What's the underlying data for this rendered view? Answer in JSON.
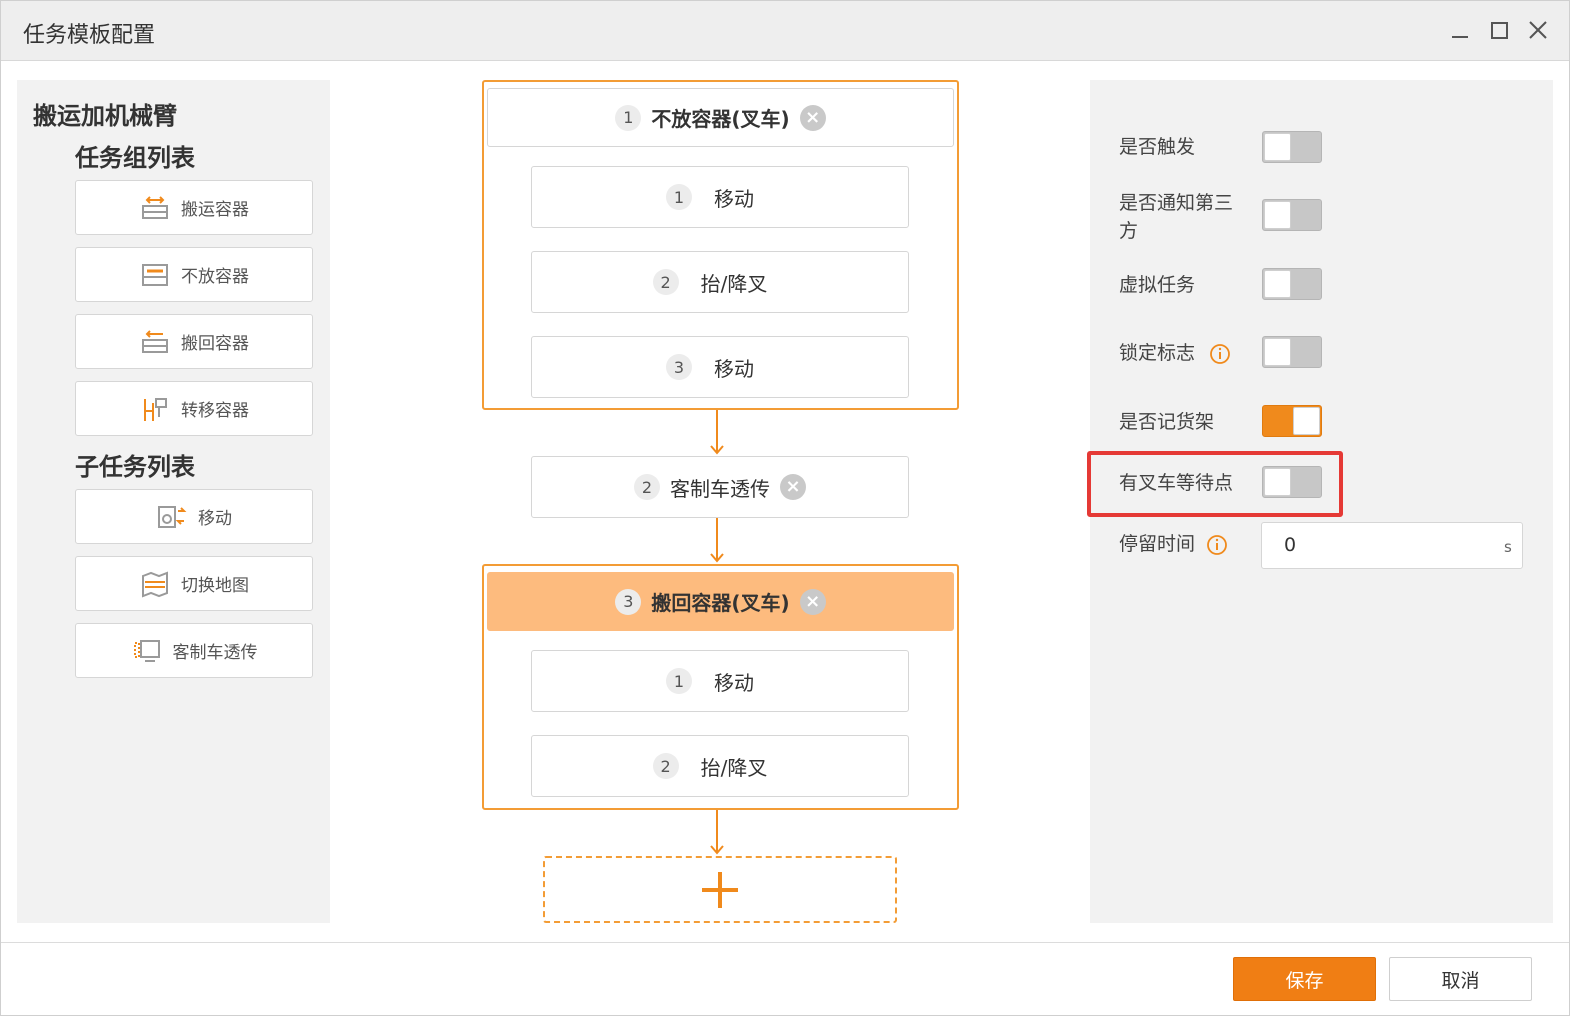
{
  "window": {
    "title": "任务模板配置"
  },
  "left": {
    "heading": "搬运加机械臂",
    "task_group_title": "任务组列表",
    "task_groups": [
      {
        "label": "搬运容器",
        "icon": "carry-container-icon"
      },
      {
        "label": "不放容器",
        "icon": "no-drop-container-icon"
      },
      {
        "label": "搬回容器",
        "icon": "return-container-icon"
      },
      {
        "label": "转移容器",
        "icon": "transfer-container-icon"
      }
    ],
    "subtask_title": "子任务列表",
    "subtasks": [
      {
        "label": "移动",
        "icon": "move-icon"
      },
      {
        "label": "切换地图",
        "icon": "switch-map-icon"
      },
      {
        "label": "客制车透传",
        "icon": "custom-vehicle-passthrough-icon"
      }
    ]
  },
  "flow": {
    "groups": [
      {
        "num": "1",
        "title": "不放容器(叉车)",
        "steps": [
          {
            "num": "1",
            "label": "移动"
          },
          {
            "num": "2",
            "label": "抬/降叉"
          },
          {
            "num": "3",
            "label": "移动"
          }
        ]
      },
      {
        "num": "2",
        "title": "客制车透传"
      },
      {
        "num": "3",
        "title": "搬回容器(叉车)",
        "active": true,
        "steps": [
          {
            "num": "1",
            "label": "移动"
          },
          {
            "num": "2",
            "label": "抬/降叉"
          }
        ]
      }
    ],
    "add_symbol": "+",
    "close_symbol": "×",
    "accent": "#f39c35"
  },
  "props": {
    "trigger": {
      "label": "是否触发",
      "on": false
    },
    "notify_line1": "是否通知第三",
    "notify_line2": "方",
    "notify_on": false,
    "virtual": {
      "label": "虚拟任务",
      "on": false
    },
    "lock": {
      "label": "锁定标志",
      "on": false
    },
    "shelf": {
      "label": "是否记货架",
      "on": true
    },
    "forklift_wait": {
      "label": "有叉车等待点",
      "on": false
    },
    "dwell": {
      "label": "停留时间",
      "value": "0",
      "unit": "s"
    }
  },
  "footer": {
    "save": "保存",
    "cancel": "取消"
  }
}
